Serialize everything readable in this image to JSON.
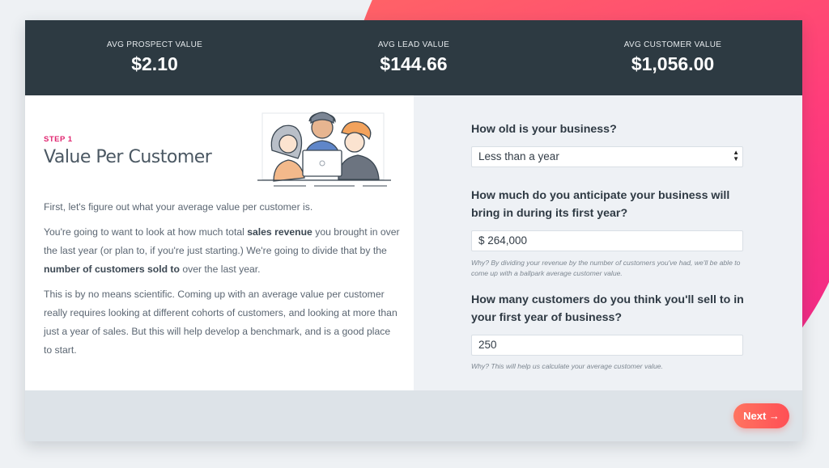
{
  "stats": [
    {
      "label": "AVG PROSPECT VALUE",
      "value": "$2.10"
    },
    {
      "label": "AVG LEAD VALUE",
      "value": "$144.66"
    },
    {
      "label": "AVG CUSTOMER VALUE",
      "value": "$1,056.00"
    }
  ],
  "step": {
    "label": "STEP 1",
    "title": "Value Per Customer"
  },
  "intro": {
    "p1": "First, let's figure out what your average value per customer is.",
    "p2_a": "You're going to want to look at how much total ",
    "p2_b": "sales revenue",
    "p2_c": " you brought in over the last year (or plan to, if you're just starting.) We're going to divide that by the ",
    "p2_d": "number of customers sold to",
    "p2_e": " over the last year.",
    "p3": "This is by no means scientific. Coming up with an average value per customer really requires looking at different cohorts of customers, and looking at more than just a year of sales. But this will help develop a benchmark, and is a good place to start."
  },
  "form": {
    "q1": "How old is your business?",
    "q1_value": "Less than a year",
    "q2": "How much do you anticipate your business will bring in during its first year?",
    "q2_value": "$ 264,000",
    "q2_hint": "Why? By dividing your revenue by the number of customers you've had, we'll be able to come up with a ballpark average customer value.",
    "q3": "How many customers do you think you'll sell to in your first year of business?",
    "q3_value": "250",
    "q3_hint": "Why? This will help us calculate your average customer value."
  },
  "footer": {
    "next_label": "Next →"
  },
  "colors": {
    "accent": "#e0246f",
    "header_bg": "#2d3a42",
    "button": "#ff5a57"
  }
}
